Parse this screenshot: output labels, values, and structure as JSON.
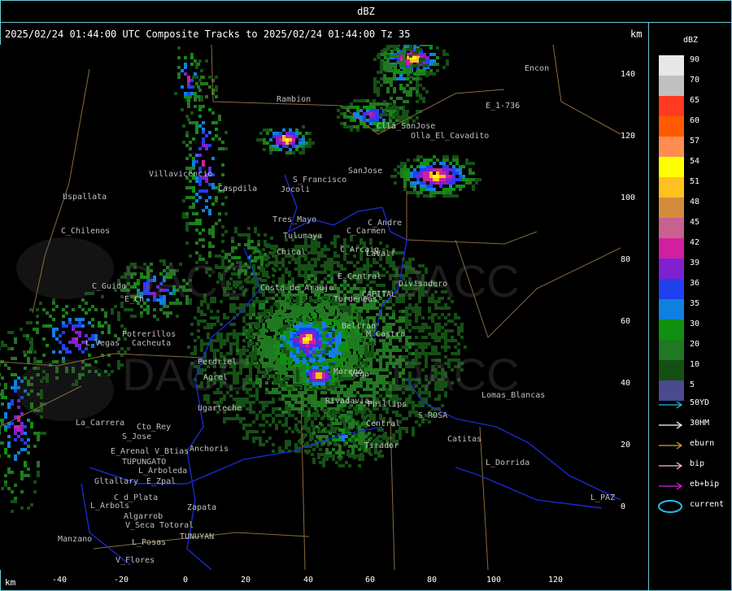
{
  "window": {
    "title": "dBZ"
  },
  "header": {
    "text": "2025/02/24 01:44:00 UTC Composite Tracks to 2025/02/24 01:44:00 Tz 35",
    "unit_top": "km",
    "unit_bottom": "km"
  },
  "axes": {
    "y_ticks": [
      "140",
      "120",
      "100",
      "80",
      "60",
      "40",
      "20",
      "0"
    ],
    "x_ticks": [
      "-40",
      "-20",
      "0",
      "20",
      "40",
      "60",
      "80",
      "100",
      "120"
    ]
  },
  "legend": {
    "title": "dBZ",
    "levels": [
      {
        "label": "90",
        "color": "#e8e8e8"
      },
      {
        "label": "70",
        "color": "#c0c0c0"
      },
      {
        "label": "65",
        "color": "#ff3a20"
      },
      {
        "label": "60",
        "color": "#ff5a00"
      },
      {
        "label": "57",
        "color": "#ff8c50"
      },
      {
        "label": "54",
        "color": "#ffff00"
      },
      {
        "label": "51",
        "color": "#ffc020"
      },
      {
        "label": "48",
        "color": "#d28c3c"
      },
      {
        "label": "45",
        "color": "#c86090"
      },
      {
        "label": "42",
        "color": "#d020a0"
      },
      {
        "label": "39",
        "color": "#8020d0"
      },
      {
        "label": "36",
        "color": "#2040f0"
      },
      {
        "label": "35",
        "color": "#1080e0"
      },
      {
        "label": "30",
        "color": "#109010"
      },
      {
        "label": "20",
        "color": "#207820"
      },
      {
        "label": "10",
        "color": "#145014"
      },
      {
        "label": "5",
        "color": "#4a4a90"
      }
    ]
  },
  "tracks": [
    {
      "label": "50YD",
      "color": "#20c0e0",
      "icon": "arrow-icon"
    },
    {
      "label": "30HM",
      "color": "#ffffff",
      "icon": "arrow-icon"
    },
    {
      "label": "eburn",
      "color": "#e0a020",
      "icon": "arrow-icon"
    },
    {
      "label": "bip",
      "color": "#ffc0c0",
      "icon": "arrow-icon"
    },
    {
      "label": "eb+bip",
      "color": "#e020e0",
      "icon": "arrow-icon"
    },
    {
      "label": "current",
      "color": "#20c0e0",
      "icon": "ellipse-icon"
    }
  ],
  "places": [
    "Encon",
    "Rambion",
    "E_1-736",
    "Clla_SanJose",
    "Olla_El_Cavadito",
    "SanJose",
    "S_Francisco",
    "Villavicencio",
    "Uspallata",
    "Caspdila",
    "Jocoli",
    "Tres_Mayo",
    "Tulumaya",
    "C_Andre",
    "C_Carmen",
    "C_Chilenos",
    "Chical",
    "C_Arcaig",
    "LaValf",
    "C_Guido",
    "Costa_de_Araujo",
    "E_Central",
    "Divisadero",
    "E_Ch",
    "Tordeneas",
    "Potrerillos",
    "L_Vegas",
    "Cacheuta",
    "Beltran",
    "M_Castro",
    "Perdriel",
    "Agrel",
    "Vega",
    "Lomas_Blancas",
    "Ugarteche",
    "Phillips",
    "Rivadavia",
    "La_Carrera",
    "Cto_Rey",
    "S_Jose",
    "Central",
    "S_ROSA",
    "Catitas",
    "E_Arenal",
    "V_Btias",
    "TUPUNGATO",
    "L_Arboleda",
    "Tirador",
    "Anchoris",
    "L_Dorrida",
    "Gltallary",
    "E_Zpal",
    "C_d_Plata",
    "Zapata",
    "L_Arbols",
    "Algarrob",
    "V_Seca",
    "Totoral",
    "L_Posas",
    "Manzano",
    "TUNUYAN",
    "V_Flores",
    "L_PAZ",
    "Moreno",
    "CAPITAL"
  ],
  "watermark": {
    "text": "DACC"
  },
  "colors": {
    "frame": "#6fc7d8",
    "county_lines": "#8b6a3e",
    "boundaries": "#1a2ad0"
  }
}
